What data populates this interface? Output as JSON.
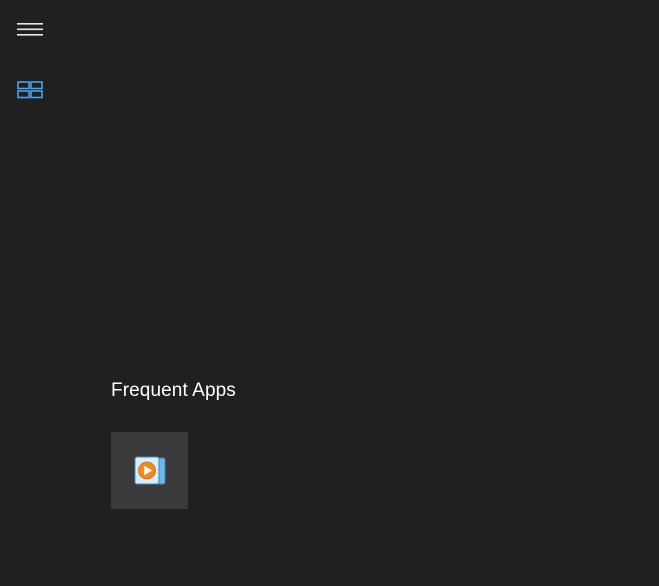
{
  "nav": {
    "menu_icon": "hamburger-icon",
    "tiles_icon": "tiles-view-icon",
    "accent_color": "#4aa3e8"
  },
  "frequent_apps": {
    "title": "Frequent Apps",
    "apps": [
      {
        "icon": "media-player-icon",
        "accent": "#f28a1c"
      }
    ]
  }
}
